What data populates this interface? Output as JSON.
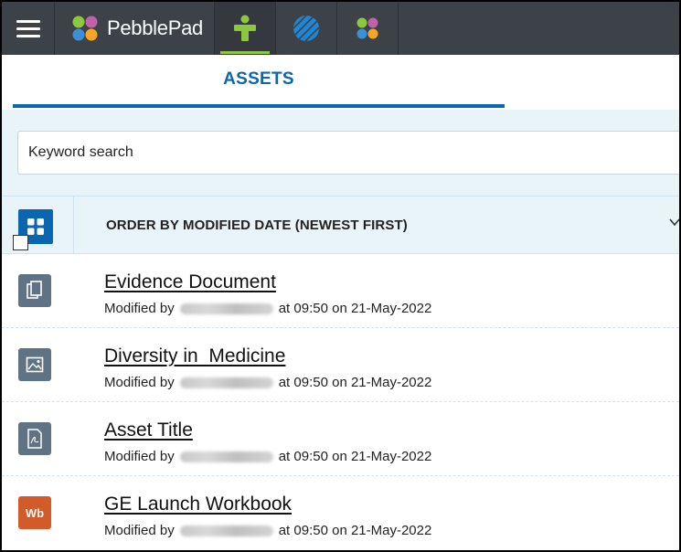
{
  "app": {
    "brand_name": "PebblePad",
    "icons": [
      "menu-icon",
      "pebblepad-logo-icon",
      "atlas-person-icon",
      "globe-icon",
      "pebble-flower-icon"
    ],
    "colors": {
      "topbar": "#3d4249",
      "accent": "#0b66b2",
      "active_underline": "#8dc63f",
      "wb_badge": "#d25b2a"
    }
  },
  "section": {
    "tab_label": "ASSETS"
  },
  "search": {
    "placeholder": "Keyword search"
  },
  "sort": {
    "label": "ORDER BY MODIFIED DATE (NEWEST FIRST)"
  },
  "assets": [
    {
      "title": "Evidence Document",
      "meta_prefix": "Modified by",
      "meta_suffix": "at 09:50 on 21-May-2022",
      "icon": "document-icon"
    },
    {
      "title": "Diversity in  Medicine",
      "meta_prefix": "Modified by",
      "meta_suffix": "at 09:50 on 21-May-2022",
      "icon": "image-icon"
    },
    {
      "title": "Asset Title",
      "meta_prefix": "Modified by",
      "meta_suffix": "at 09:50 on 21-May-2022",
      "icon": "pdf-file-icon"
    },
    {
      "title": "GE Launch Workbook",
      "meta_prefix": "Modified by",
      "meta_suffix": "at 09:50 on 21-May-2022",
      "icon": "workbook-icon",
      "badge": "Wb"
    }
  ]
}
